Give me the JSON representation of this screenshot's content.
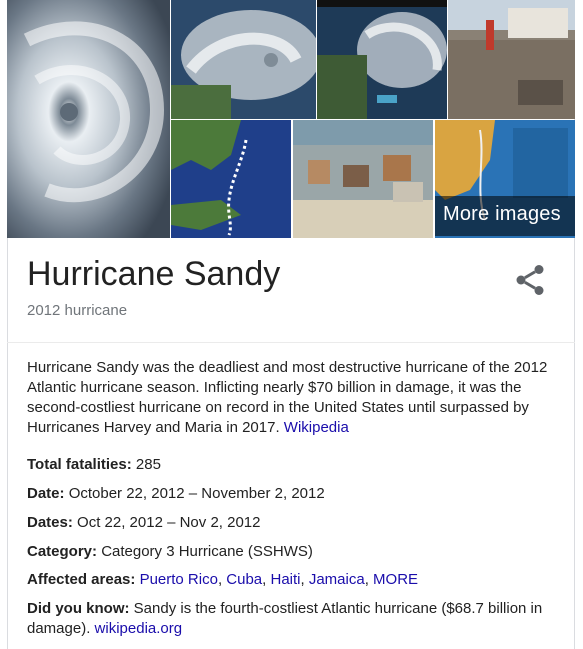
{
  "images": {
    "more_label": "More images",
    "tiles": [
      {
        "name": "satellite-swirl"
      },
      {
        "name": "satellite-east-coast"
      },
      {
        "name": "satellite-night"
      },
      {
        "name": "storm-damage-person"
      },
      {
        "name": "storm-track-map"
      },
      {
        "name": "aerial-damaged-homes"
      },
      {
        "name": "info-map"
      }
    ]
  },
  "header": {
    "title": "Hurricane Sandy",
    "subtitle": "2012 hurricane",
    "share_icon": "share-icon"
  },
  "description": {
    "text": "Hurricane Sandy was the deadliest and most destructive hurricane of the 2012 Atlantic hurricane season. Inflicting nearly $70 billion in damage, it was the second-costliest hurricane on record in the United States until surpassed by Hurricanes Harvey and Maria in 2017.",
    "source_link": "Wikipedia"
  },
  "facts": {
    "fatalities": {
      "label": "Total fatalities:",
      "value": "285"
    },
    "date": {
      "label": "Date:",
      "value": "October 22, 2012 – November 2, 2012"
    },
    "dates": {
      "label": "Dates:",
      "value": "Oct 22, 2012 – Nov 2, 2012"
    },
    "category": {
      "label": "Category:",
      "value": "Category 3 Hurricane (SSHWS)"
    },
    "affected": {
      "label": "Affected areas:",
      "links": [
        "Puerto Rico",
        "Cuba",
        "Haiti",
        "Jamaica",
        "MORE"
      ],
      "sep": ","
    },
    "did_you_know": {
      "label": "Did you know:",
      "value": "Sandy is the fourth-costliest Atlantic hurricane ($68.7 billion in damage).",
      "link": "wikipedia.org"
    }
  },
  "colors": {
    "link": "#1a0dab",
    "subtitle": "#70757a",
    "text": "#222222"
  }
}
